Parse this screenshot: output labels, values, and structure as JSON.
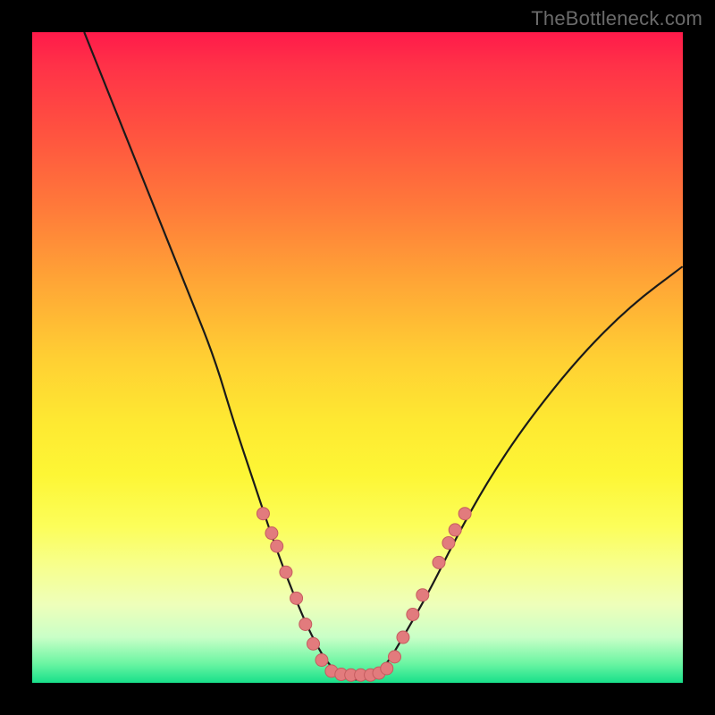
{
  "watermark": "TheBottleneck.com",
  "chart_data": {
    "type": "line",
    "title": "",
    "xlabel": "",
    "ylabel": "",
    "xlim": [
      0,
      100
    ],
    "ylim": [
      0,
      100
    ],
    "grid": false,
    "legend": false,
    "description": "V-shaped bottleneck curve over vertical red-to-green gradient; minimum near x≈45–55 at y≈0.",
    "curve_points": [
      {
        "x": 8,
        "y": 100
      },
      {
        "x": 12,
        "y": 90
      },
      {
        "x": 16,
        "y": 80
      },
      {
        "x": 20,
        "y": 70
      },
      {
        "x": 24,
        "y": 60
      },
      {
        "x": 28,
        "y": 50
      },
      {
        "x": 31,
        "y": 40
      },
      {
        "x": 34,
        "y": 31
      },
      {
        "x": 37,
        "y": 22
      },
      {
        "x": 40,
        "y": 14
      },
      {
        "x": 43,
        "y": 7
      },
      {
        "x": 46,
        "y": 2
      },
      {
        "x": 50,
        "y": 0
      },
      {
        "x": 54,
        "y": 2
      },
      {
        "x": 57,
        "y": 7
      },
      {
        "x": 61,
        "y": 14
      },
      {
        "x": 65,
        "y": 22
      },
      {
        "x": 70,
        "y": 31
      },
      {
        "x": 76,
        "y": 40
      },
      {
        "x": 84,
        "y": 50
      },
      {
        "x": 92,
        "y": 58
      },
      {
        "x": 100,
        "y": 64
      }
    ],
    "markers": [
      {
        "x": 35.5,
        "y": 26
      },
      {
        "x": 36.8,
        "y": 23
      },
      {
        "x": 37.6,
        "y": 21
      },
      {
        "x": 39.0,
        "y": 17
      },
      {
        "x": 40.6,
        "y": 13
      },
      {
        "x": 42.0,
        "y": 9
      },
      {
        "x": 43.2,
        "y": 6
      },
      {
        "x": 44.5,
        "y": 3.5
      },
      {
        "x": 46.0,
        "y": 1.8
      },
      {
        "x": 47.5,
        "y": 1.3
      },
      {
        "x": 49.0,
        "y": 1.2
      },
      {
        "x": 50.5,
        "y": 1.2
      },
      {
        "x": 52.0,
        "y": 1.2
      },
      {
        "x": 53.3,
        "y": 1.5
      },
      {
        "x": 54.5,
        "y": 2.2
      },
      {
        "x": 55.7,
        "y": 4.0
      },
      {
        "x": 57.0,
        "y": 7.0
      },
      {
        "x": 58.5,
        "y": 10.5
      },
      {
        "x": 60.0,
        "y": 13.5
      },
      {
        "x": 62.5,
        "y": 18.5
      },
      {
        "x": 64.0,
        "y": 21.5
      },
      {
        "x": 65.0,
        "y": 23.5
      },
      {
        "x": 66.5,
        "y": 26.0
      }
    ],
    "gradient_stops": [
      {
        "pos": 0,
        "color": "#ff1a4a"
      },
      {
        "pos": 50,
        "color": "#ffcf33"
      },
      {
        "pos": 100,
        "color": "#18e08a"
      }
    ]
  }
}
